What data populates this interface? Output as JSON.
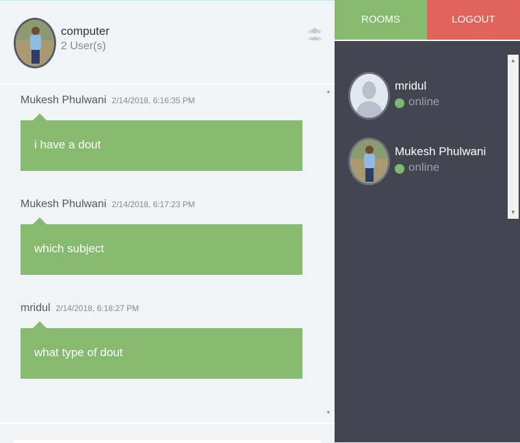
{
  "room": {
    "name": "computer",
    "user_count": "2 User(s)"
  },
  "nav": {
    "rooms_label": "ROOMS",
    "logout_label": "LOGOUT"
  },
  "messages": [
    {
      "author": "Mukesh Phulwani",
      "time": "2/14/2018, 6:16:35 PM",
      "text": "i have a dout"
    },
    {
      "author": "Mukesh Phulwani",
      "time": "2/14/2018, 6:17:23 PM",
      "text": "which subject"
    },
    {
      "author": "mridul",
      "time": "2/14/2018, 6:18:27 PM",
      "text": "what type of dout"
    }
  ],
  "users": [
    {
      "name": "mridul",
      "status": "online",
      "avatar": "default-avatar-icon"
    },
    {
      "name": "Mukesh Phulwani",
      "status": "online",
      "avatar": "photo-avatar"
    }
  ],
  "colors": {
    "accent_green": "#86bb6f",
    "logout_red": "#e0645b",
    "sidebar_bg": "#434651",
    "online_dot": "#7fba6c"
  }
}
